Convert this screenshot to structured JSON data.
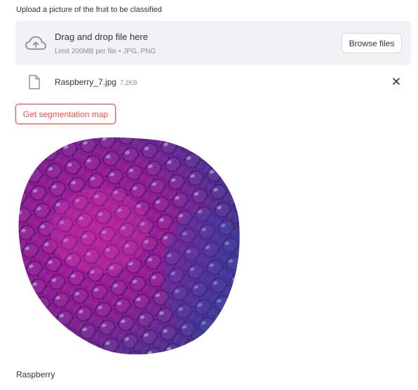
{
  "uploader": {
    "label": "Upload a picture of the fruit to be classified",
    "dropzone_title": "Drag and drop file here",
    "dropzone_subtitle": "Limit 200MB per file • JPG, PNG",
    "browse_label": "Browse files",
    "upload_icon": "cloud-upload-icon"
  },
  "uploaded_file": {
    "name": "Raspberry_7.jpg",
    "size": "7.2KB",
    "file_icon": "file-icon",
    "remove_icon": "close-icon"
  },
  "actions": {
    "segmentation_label": "Get segmentation map"
  },
  "result": {
    "label": "Raspberry"
  },
  "colors": {
    "accent": "#ff4b4b",
    "dropzone_bg": "#f0f2f6",
    "text": "#31333f",
    "muted": "#8c8e98"
  }
}
